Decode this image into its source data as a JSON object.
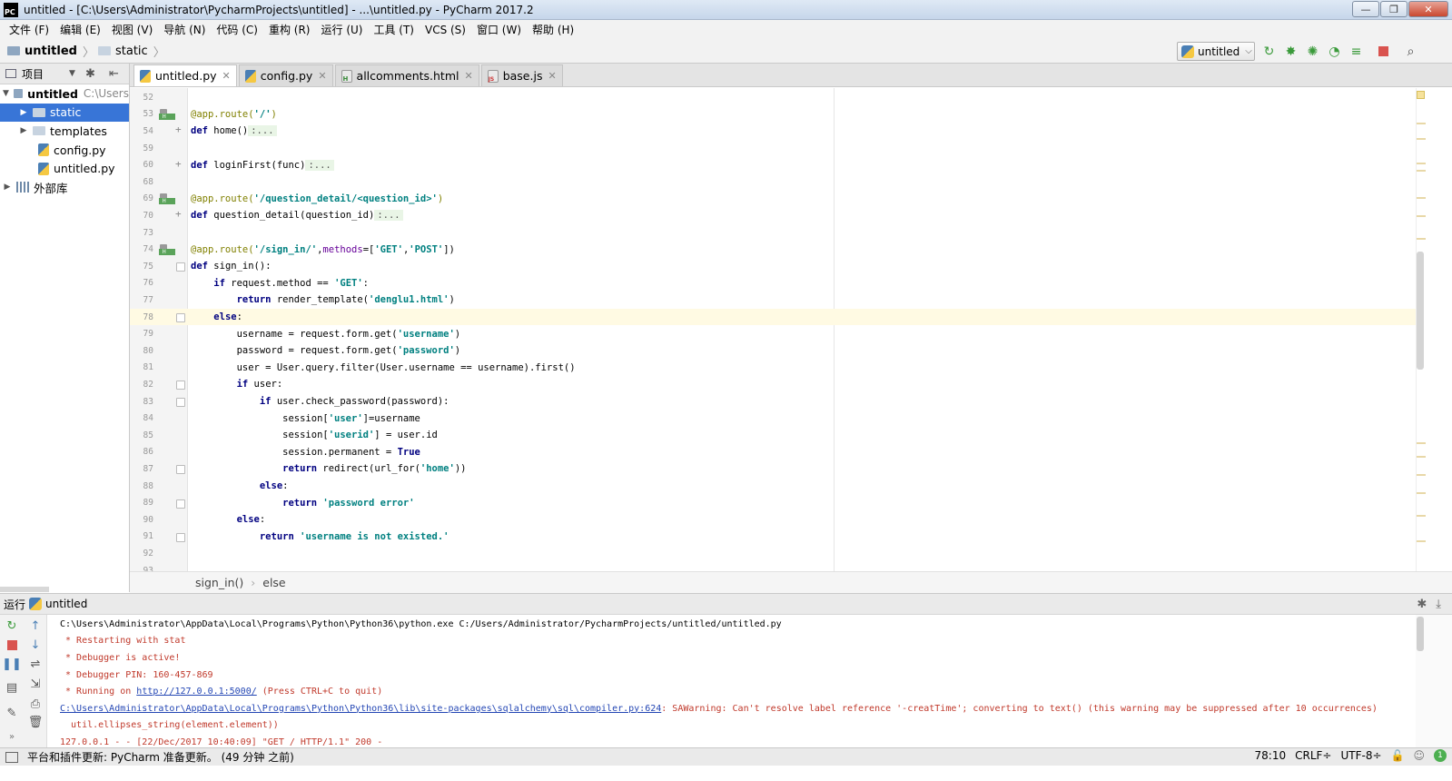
{
  "window": {
    "title": "untitled - [C:\\Users\\Administrator\\PycharmProjects\\untitled] - ...\\untitled.py - PyCharm 2017.2",
    "controls": [
      "—",
      "❐",
      "✕"
    ]
  },
  "menu": [
    "文件 (F)",
    "编辑 (E)",
    "视图 (V)",
    "导航 (N)",
    "代码 (C)",
    "重构 (R)",
    "运行 (U)",
    "工具 (T)",
    "VCS (S)",
    "窗口 (W)",
    "帮助 (H)"
  ],
  "breadcrumb": {
    "root": "untitled",
    "child": "static"
  },
  "run_config": {
    "label": "untitled"
  },
  "project_panel": {
    "header": "项目",
    "root_label": "untitled",
    "root_path": "C:\\Users",
    "items": [
      {
        "label": "static",
        "type": "folder",
        "expandable": true,
        "selected": true
      },
      {
        "label": "templates",
        "type": "folder",
        "expandable": true,
        "selected": false
      },
      {
        "label": "config.py",
        "type": "python-file",
        "expandable": false,
        "selected": false
      },
      {
        "label": "untitled.py",
        "type": "python-file",
        "expandable": false,
        "selected": false
      }
    ],
    "external_libs": "外部库"
  },
  "tabs": [
    {
      "label": "untitled.py",
      "icon": "python-file-icon",
      "active": true
    },
    {
      "label": "config.py",
      "icon": "python-file-icon",
      "active": false
    },
    {
      "label": "allcomments.html",
      "icon": "html-file-icon",
      "active": false
    },
    {
      "label": "base.js",
      "icon": "js-file-icon",
      "active": false
    }
  ],
  "editor": {
    "current_line": "78",
    "lines": [
      {
        "n": "52",
        "segs": []
      },
      {
        "n": "53",
        "gicon": true,
        "segs": [
          [
            "deco",
            "@app.route("
          ],
          [
            "str",
            "'/'"
          ],
          [
            "deco",
            ")"
          ]
        ]
      },
      {
        "n": "54",
        "fold": "plus",
        "segs": [
          [
            "kw",
            "def "
          ],
          [
            "",
            "home()"
          ],
          [
            "folded",
            ":..."
          ]
        ]
      },
      {
        "n": "59",
        "segs": []
      },
      {
        "n": "60",
        "fold": "plus",
        "segs": [
          [
            "kw",
            "def "
          ],
          [
            "",
            "loginFirst(func)"
          ],
          [
            "folded",
            ":..."
          ]
        ]
      },
      {
        "n": "68",
        "segs": []
      },
      {
        "n": "69",
        "gicon": true,
        "segs": [
          [
            "deco",
            "@app.route("
          ],
          [
            "str",
            "'/question_detail/<question_id>'"
          ],
          [
            "deco",
            ")"
          ]
        ]
      },
      {
        "n": "70",
        "fold": "plus",
        "segs": [
          [
            "kw",
            "def "
          ],
          [
            "",
            "question_detail(question_id)"
          ],
          [
            "folded",
            ":..."
          ]
        ]
      },
      {
        "n": "73",
        "segs": []
      },
      {
        "n": "74",
        "gicon": true,
        "segs": [
          [
            "deco",
            "@app.route("
          ],
          [
            "str",
            "'/sign_in/'"
          ],
          [
            "",
            ","
          ],
          [
            "param",
            "methods"
          ],
          [
            "",
            "=["
          ],
          [
            "str",
            "'GET'"
          ],
          [
            "",
            ","
          ],
          [
            "str",
            "'POST'"
          ],
          [
            "",
            "])"
          ]
        ]
      },
      {
        "n": "75",
        "fold": "mark",
        "segs": [
          [
            "kw",
            "def "
          ],
          [
            "",
            "sign_in():"
          ]
        ]
      },
      {
        "n": "76",
        "segs": [
          [
            "",
            "    "
          ],
          [
            "kw",
            "if "
          ],
          [
            "",
            "request.method == "
          ],
          [
            "str",
            "'GET'"
          ],
          [
            "",
            ":"
          ]
        ]
      },
      {
        "n": "77",
        "segs": [
          [
            "",
            "        "
          ],
          [
            "kw",
            "return "
          ],
          [
            "",
            "render_template("
          ],
          [
            "str",
            "'denglu1.html'"
          ],
          [
            "",
            ")"
          ]
        ]
      },
      {
        "n": "78",
        "fold": "mark",
        "segs": [
          [
            "",
            "    "
          ],
          [
            "kw",
            "else"
          ],
          [
            "",
            ":"
          ]
        ]
      },
      {
        "n": "79",
        "segs": [
          [
            "",
            "        username = request.form.get("
          ],
          [
            "str",
            "'username'"
          ],
          [
            "",
            ")"
          ]
        ]
      },
      {
        "n": "80",
        "segs": [
          [
            "",
            "        password = request.form.get("
          ],
          [
            "str",
            "'password'"
          ],
          [
            "",
            ")"
          ]
        ]
      },
      {
        "n": "81",
        "segs": [
          [
            "",
            "        user = User.query.filter(User.username == username).first()"
          ]
        ]
      },
      {
        "n": "82",
        "fold": "mark",
        "segs": [
          [
            "",
            "        "
          ],
          [
            "kw",
            "if "
          ],
          [
            "",
            "user:"
          ]
        ]
      },
      {
        "n": "83",
        "fold": "mark",
        "segs": [
          [
            "",
            "            "
          ],
          [
            "kw",
            "if "
          ],
          [
            "",
            "user.check_password(password):"
          ]
        ]
      },
      {
        "n": "84",
        "segs": [
          [
            "",
            "                session["
          ],
          [
            "str",
            "'user'"
          ],
          [
            "",
            "]=username"
          ]
        ]
      },
      {
        "n": "85",
        "segs": [
          [
            "",
            "                session["
          ],
          [
            "str",
            "'userid'"
          ],
          [
            "",
            "] = user.id"
          ]
        ]
      },
      {
        "n": "86",
        "segs": [
          [
            "",
            "                session.permanent = "
          ],
          [
            "kw",
            "True"
          ]
        ]
      },
      {
        "n": "87",
        "fold": "mark",
        "segs": [
          [
            "",
            "                "
          ],
          [
            "kw",
            "return "
          ],
          [
            "",
            "redirect(url_for("
          ],
          [
            "str",
            "'home'"
          ],
          [
            "",
            "))"
          ]
        ]
      },
      {
        "n": "88",
        "segs": [
          [
            "",
            "            "
          ],
          [
            "kw",
            "else"
          ],
          [
            "",
            ":"
          ]
        ]
      },
      {
        "n": "89",
        "fold": "mark",
        "segs": [
          [
            "",
            "                "
          ],
          [
            "kw",
            "return "
          ],
          [
            "str",
            "'password error'"
          ]
        ]
      },
      {
        "n": "90",
        "segs": [
          [
            "",
            "        "
          ],
          [
            "kw",
            "else"
          ],
          [
            "",
            ":"
          ]
        ]
      },
      {
        "n": "91",
        "fold": "mark",
        "segs": [
          [
            "",
            "            "
          ],
          [
            "kw",
            "return "
          ],
          [
            "str",
            "'username is not existed.'"
          ]
        ]
      },
      {
        "n": "92",
        "segs": []
      },
      {
        "n": "93",
        "segs": []
      }
    ]
  },
  "code_breadcrumb": [
    "sign_in()",
    "else"
  ],
  "run_panel": {
    "label": "运行",
    "config": "untitled",
    "lines": [
      {
        "segs": [
          [
            "",
            "C:\\Users\\Administrator\\AppData\\Local\\Programs\\Python\\Python36\\python.exe C:/Users/Administrator/PycharmProjects/untitled/untitled.py"
          ]
        ]
      },
      {
        "segs": [
          [
            "red",
            " * Restarting with stat"
          ]
        ]
      },
      {
        "segs": [
          [
            "red",
            " * Debugger is active!"
          ]
        ]
      },
      {
        "segs": [
          [
            "red",
            " * Debugger PIN: 160-457-869"
          ]
        ]
      },
      {
        "segs": [
          [
            "red",
            " * Running on "
          ],
          [
            "link",
            "http://127.0.0.1:5000/"
          ],
          [
            "red",
            " (Press CTRL+C to quit)"
          ]
        ]
      },
      {
        "segs": [
          [
            "link",
            "C:\\Users\\Administrator\\AppData\\Local\\Programs\\Python\\Python36\\lib\\site-packages\\sqlalchemy\\sql\\compiler.py:624"
          ],
          [
            "red",
            ": SAWarning: Can't resolve label reference '-creatTime'; converting to text() (this warning may be suppressed after 10 occurrences)"
          ]
        ]
      },
      {
        "segs": [
          [
            "red",
            "  util.ellipses_string(element.element))"
          ]
        ]
      },
      {
        "segs": [
          [
            "red",
            "127.0.0.1 - - [22/Dec/2017 10:40:09] \"GET / HTTP/1.1\" 200 -"
          ]
        ]
      }
    ]
  },
  "status": {
    "message": "平台和插件更新: PyCharm 准备更新。 (49 分钟 之前)",
    "position": "78:10",
    "line_sep": "CRLF÷",
    "encoding": "UTF-8÷",
    "notifications": "1"
  }
}
